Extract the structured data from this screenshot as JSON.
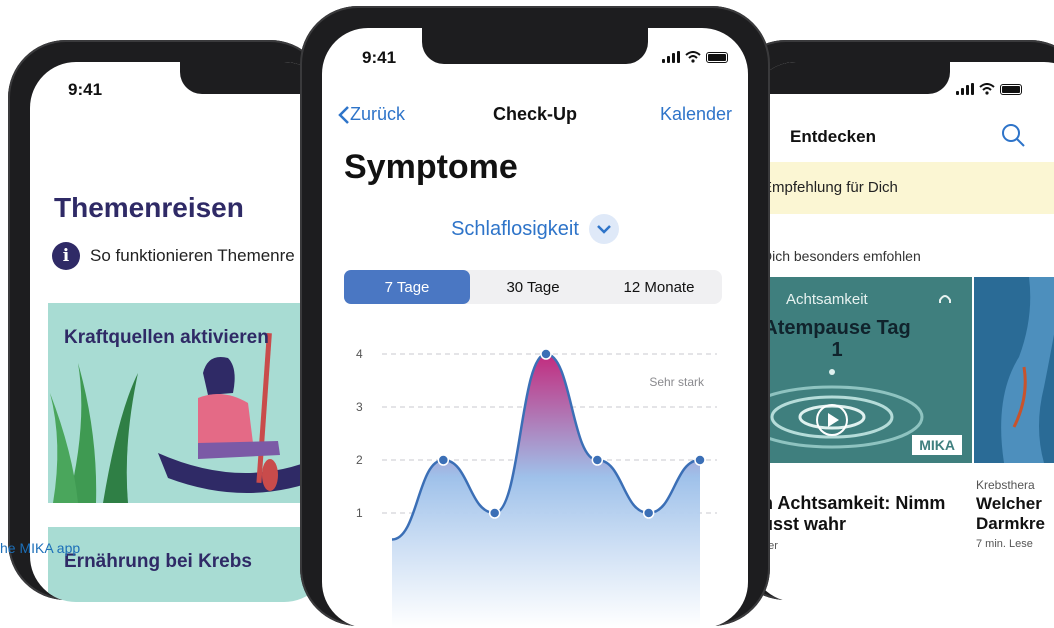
{
  "status": {
    "time": "9:41"
  },
  "left_phone": {
    "title": "Themenreisen",
    "info_text": "So funktionieren Themenre",
    "card1_title": "Kraftquellen aktivieren",
    "card2_title": "Ernährung bei Krebs"
  },
  "center_phone": {
    "back_label": "Zurück",
    "nav_title": "Check-Up",
    "nav_right": "Kalender",
    "heading": "Symptome",
    "dropdown_value": "Schlaflosigkeit",
    "segments": [
      "7 Tage",
      "30 Tage",
      "12 Monate"
    ],
    "selected_segment": "7 Tage"
  },
  "chart_data": {
    "type": "area",
    "y_ticks": [
      "4",
      "3",
      "2",
      "1"
    ],
    "ylim": [
      0,
      4
    ],
    "values": [
      0.5,
      2,
      1,
      4,
      2,
      1,
      2
    ],
    "annotation": "Sehr stark",
    "colors": {
      "line": "#3b6fb6",
      "fill_low": "#9fc1ea",
      "fill_high": "#c22b7e"
    }
  },
  "right_phone": {
    "title": "Entdecken",
    "banner": "Empfehlung für Dich",
    "subtitle": "Dich besonders emfohlen",
    "tile1_category": "Achtsamkeit",
    "tile1_title": "Atempause Tag 1",
    "tile1_brand": "MIKA",
    "item1_line1": "n Achtsamkeit: Nimm",
    "item1_line2": "usst wahr",
    "item1_meta": "uer",
    "item2_category": "Krebsthera",
    "item2_line1": "Welcher",
    "item2_line2": "Darmkre",
    "item2_meta": "7 min. Lese"
  },
  "caption": "he MIKA app"
}
